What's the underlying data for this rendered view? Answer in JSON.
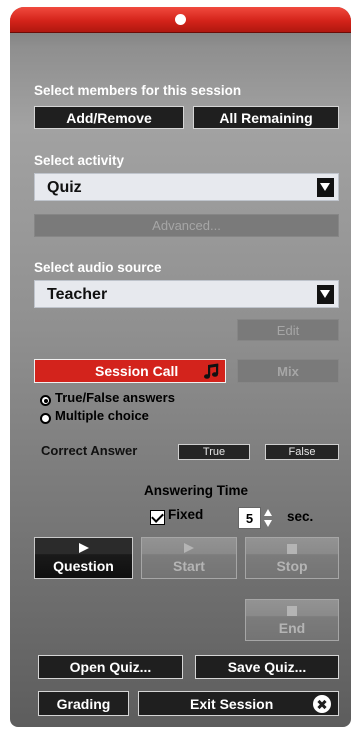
{
  "members": {
    "label": "Select members for this session",
    "add_remove": "Add/Remove",
    "all_remaining": "All Remaining"
  },
  "activity": {
    "label": "Select activity",
    "selected": "Quiz",
    "advanced": "Advanced..."
  },
  "audio": {
    "label": "Select audio source",
    "selected": "Teacher",
    "edit": "Edit"
  },
  "session_call": "Session Call",
  "mix": "Mix",
  "answer_type": {
    "options": [
      "True/False answers",
      "Multiple choice"
    ],
    "selected": "True/False answers"
  },
  "correct_answer": {
    "label": "Correct Answer",
    "true_label": "True",
    "false_label": "False"
  },
  "answering_time": {
    "label": "Answering Time",
    "fixed_label": "Fixed",
    "fixed_checked": true,
    "value": "5",
    "unit": "sec."
  },
  "controls": {
    "question": "Question",
    "start": "Start",
    "stop": "Stop",
    "end": "End"
  },
  "footer": {
    "open_quiz": "Open Quiz...",
    "save_quiz": "Save Quiz...",
    "grading": "Grading",
    "exit_session": "Exit Session"
  },
  "colors": {
    "title_bar": "#d4231a",
    "session_call": "#d3231c",
    "panel": "#999999"
  },
  "icons": [
    "title-dot-icon",
    "dropdown-arrow-icon",
    "music-note-icon",
    "play-icon",
    "stop-icon",
    "close-circle-icon",
    "checkmark-icon",
    "spinner-arrows-icon"
  ]
}
